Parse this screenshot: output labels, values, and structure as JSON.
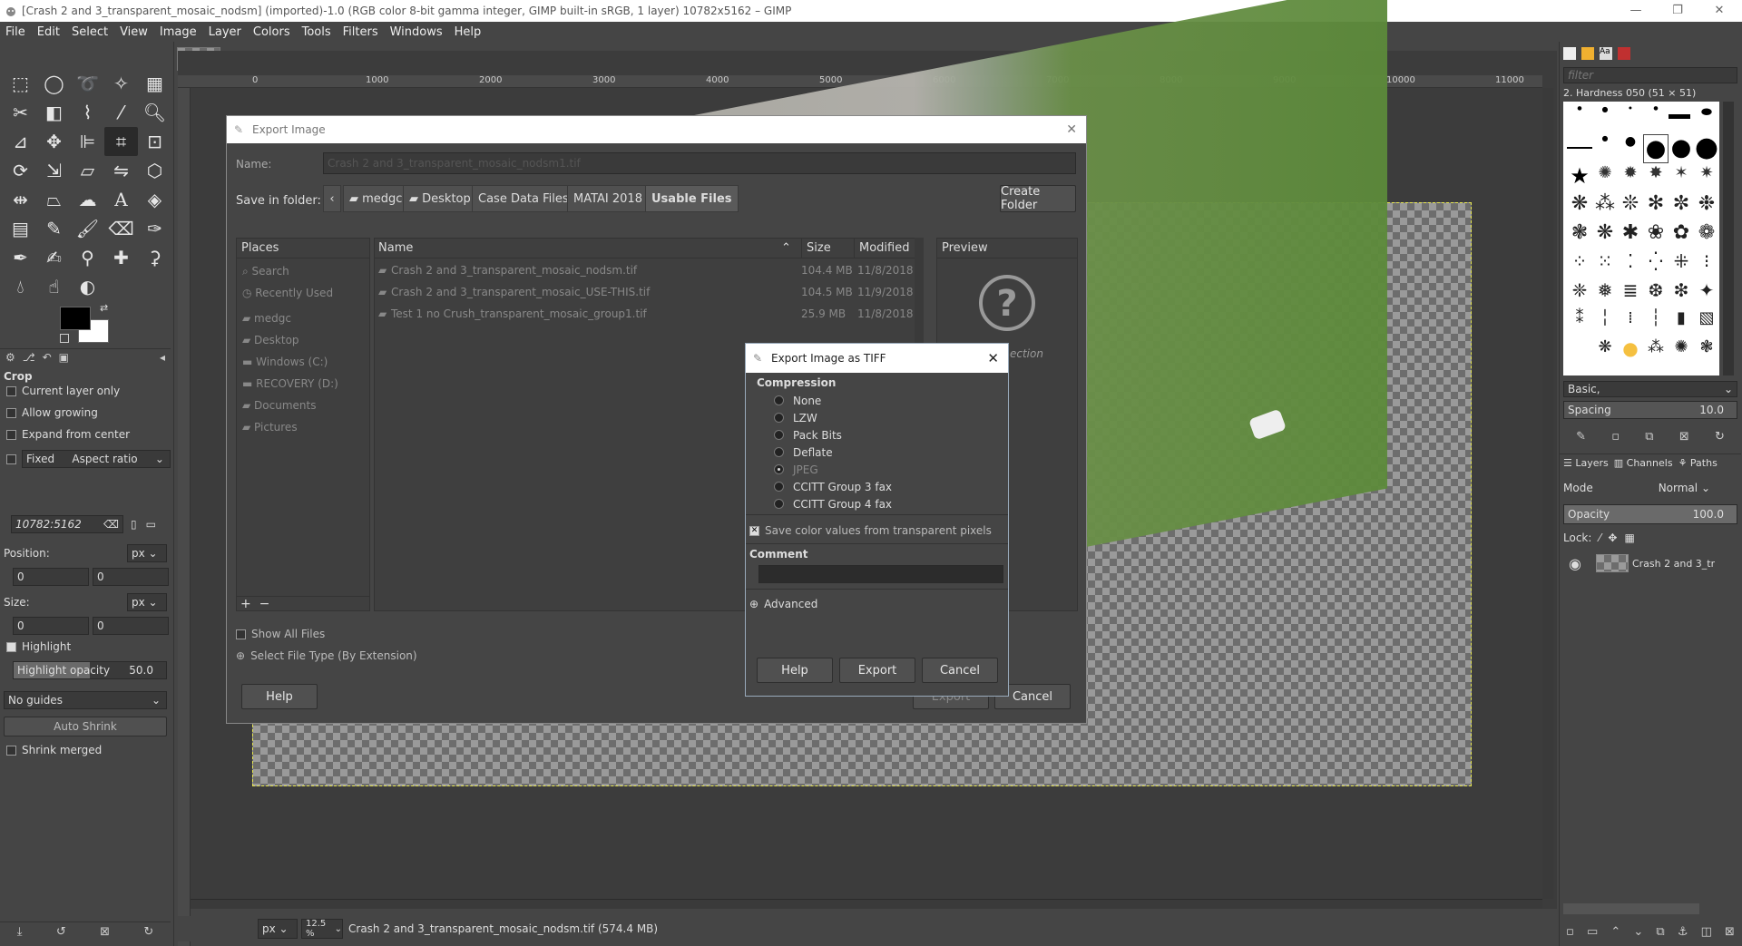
{
  "window": {
    "title": "[Crash 2 and 3_transparent_mosaic_nodsm] (imported)-1.0 (RGB color 8-bit gamma integer, GIMP built-in sRGB, 1 layer) 10782x5162 – GIMP"
  },
  "menu": [
    "File",
    "Edit",
    "Select",
    "View",
    "Image",
    "Layer",
    "Colors",
    "Tools",
    "Filters",
    "Windows",
    "Help"
  ],
  "ruler": {
    "marks": [
      "0",
      "1000",
      "2000",
      "3000",
      "4000",
      "5000",
      "6000",
      "7000",
      "8000",
      "9000",
      "10000",
      "11000"
    ]
  },
  "tool_options": {
    "title": "Crop",
    "current_layer_only": "Current layer only",
    "allow_growing": "Allow growing",
    "expand_from_center": "Expand from center",
    "fixed": "Fixed",
    "aspect_ratio": "Aspect ratio",
    "ratio_value": "10782:5162",
    "position_label": "Position:",
    "position_unit": "px",
    "pos_x": "0",
    "pos_y": "0",
    "size_label": "Size:",
    "size_unit": "px",
    "size_x": "0",
    "size_y": "0",
    "highlight": "Highlight",
    "highlight_opacity_label": "Highlight opacity",
    "highlight_opacity": "50.0",
    "guides": "No guides",
    "auto_shrink": "Auto Shrink",
    "shrink_merged": "Shrink merged"
  },
  "statusbar": {
    "unit": "px",
    "zoom": "12.5 %",
    "text": "Crash 2 and 3_transparent_mosaic_nodsm.tif (574.4 MB)"
  },
  "dock": {
    "filter_placeholder": "filter",
    "brush_name": "2. Hardness 050 (51 × 51)",
    "brush_set": "Basic,",
    "spacing_label": "Spacing",
    "spacing_value": "10.0",
    "tabs": {
      "layers": "Layers",
      "channels": "Channels",
      "paths": "Paths"
    },
    "mode_label": "Mode",
    "mode_value": "Normal",
    "opacity_label": "Opacity",
    "opacity_value": "100.0",
    "lock_label": "Lock:",
    "layer_name": "Crash 2 and 3_tr"
  },
  "export_dialog": {
    "title": "Export Image",
    "name_label": "Name:",
    "name_value": "Crash 2 and 3_transparent_mosaic_nodsm1.tif",
    "save_in_label": "Save in folder:",
    "breadcrumbs": [
      "medgc",
      "Desktop",
      "Case Data Files",
      "MATAI 2018",
      "Usable Files"
    ],
    "create_folder": "Create Folder",
    "places_header": "Places",
    "places": [
      "Search",
      "Recently Used",
      "medgc",
      "Desktop",
      "Windows (C:)",
      "RECOVERY (D:)",
      "Documents",
      "Pictures"
    ],
    "columns": {
      "name": "Name",
      "size": "Size",
      "modified": "Modified"
    },
    "files": [
      {
        "name": "Crash 2 and 3_transparent_mosaic_nodsm.tif",
        "size": "104.4 MB",
        "modified": "11/8/2018"
      },
      {
        "name": "Crash 2 and 3_transparent_mosaic_USE-THIS.tif",
        "size": "104.5 MB",
        "modified": "11/9/2018"
      },
      {
        "name": "Test 1 no Crush_transparent_mosaic_group1.tif",
        "size": "25.9 MB",
        "modified": "11/8/2018"
      }
    ],
    "preview_header": "Preview",
    "preview_text": "ection",
    "show_all_files": "Show All Files",
    "select_file_type": "Select File Type (By Extension)",
    "help": "Help",
    "export": "Export",
    "cancel": "Cancel"
  },
  "tiff_dialog": {
    "title": "Export Image as TIFF",
    "compression_label": "Compression",
    "options": [
      "None",
      "LZW",
      "Pack Bits",
      "Deflate",
      "JPEG",
      "CCITT Group 3 fax",
      "CCITT Group 4 fax"
    ],
    "selected": "JPEG",
    "save_color": "Save color values from transparent pixels",
    "comment_label": "Comment",
    "comment_value": "",
    "advanced": "Advanced",
    "help": "Help",
    "export": "Export",
    "cancel": "Cancel"
  }
}
